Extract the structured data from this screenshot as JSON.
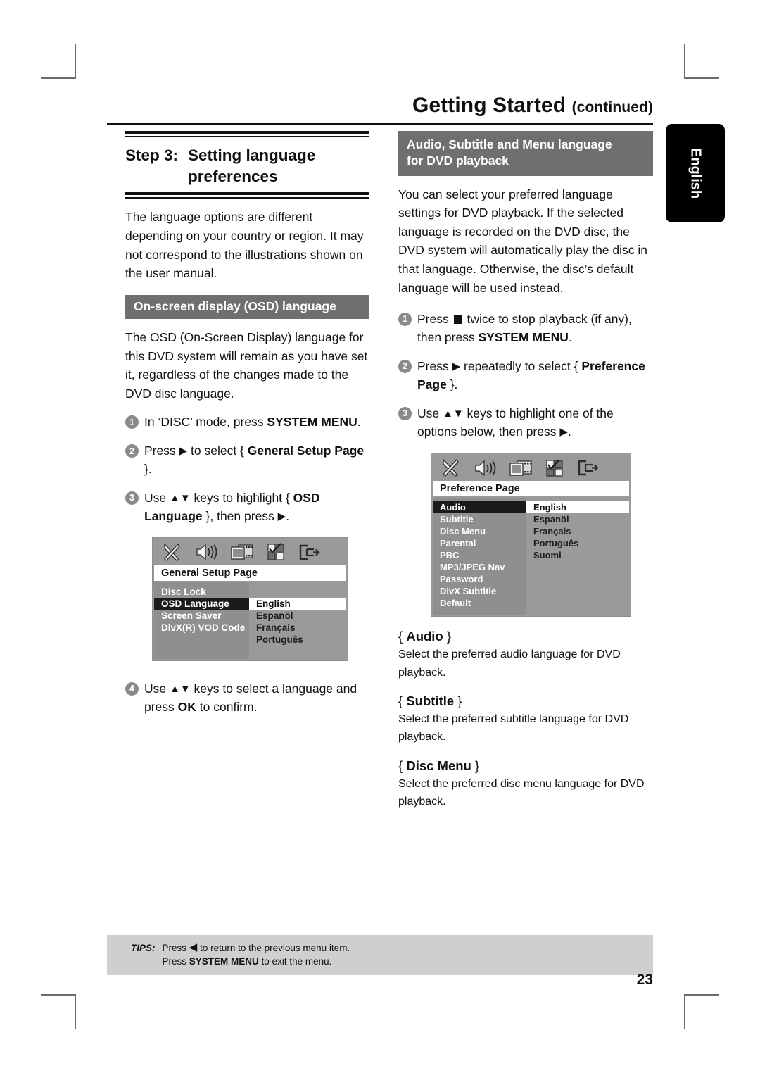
{
  "header": {
    "title": "Getting Started",
    "continued": "(continued)"
  },
  "side_tab": {
    "label": "English"
  },
  "left_column": {
    "step_label": "Step 3:",
    "step_title_line1": "Setting language",
    "step_title_line2": "preferences",
    "intro": "The language options are different depending on your country or region. It may not correspond to the illustrations shown on the user manual.",
    "section_bar": "On-screen display (OSD) language",
    "section_body": "The OSD (On-Screen Display) language for this DVD system will remain as you have set it, regardless of the changes made to the DVD disc language.",
    "steps": [
      {
        "num": "1",
        "html": "In &#8216;DISC&#8217; mode, press <b>SYSTEM MENU</b>."
      },
      {
        "num": "2",
        "html": "Press <span class=\"ar\">&#9654;</span> to select { <b>General Setup Page</b> }."
      },
      {
        "num": "3",
        "html": "Use <span class=\"ar\">&#9650;&#9660;</span> keys to highlight { <b>OSD Language</b> }, then press <span class=\"ar\">&#9654;</span>."
      },
      {
        "num": "4",
        "html": "Use <span class=\"ar\">&#9650;&#9660;</span> keys to select a language and press <b>OK</b> to confirm."
      }
    ],
    "osd": {
      "title": "General Setup Page",
      "icons": [
        "tools-icon",
        "speaker-icon",
        "film-icon",
        "preference-icon",
        "exit-icon"
      ],
      "menu_items": [
        "Disc Lock",
        "OSD Language",
        "Screen Saver",
        "DivX(R) VOD Code"
      ],
      "selected_item": "OSD Language",
      "options": [
        "English",
        "Espanöl",
        "Français",
        "Português"
      ],
      "selected_option": "English"
    }
  },
  "right_column": {
    "section_bar_line1": "Audio, Subtitle and Menu language",
    "section_bar_line2": "for DVD playback",
    "intro": "You can select your preferred language settings for DVD playback.  If the selected language is recorded on the DVD disc, the DVD system will automatically play the disc in that language.  Otherwise, the disc’s default language will be used instead.",
    "steps": [
      {
        "num": "1",
        "html": "Press <span class=\"sq\"></span> twice to stop playback (if any), then press <b>SYSTEM MENU</b>."
      },
      {
        "num": "2",
        "html": "Press <span class=\"ar\">&#9654;</span> repeatedly to select { <b>Preference Page</b> }."
      },
      {
        "num": "3",
        "html": "Use <span class=\"ar\">&#9650;&#9660;</span> keys to highlight one of the options below, then press <span class=\"ar\">&#9654;</span>."
      }
    ],
    "osd": {
      "title": "Preference Page",
      "icons": [
        "tools-icon",
        "speaker-icon",
        "film-icon",
        "preference-icon",
        "exit-icon"
      ],
      "menu_items": [
        "Audio",
        "Subtitle",
        "Disc Menu",
        "Parental",
        "PBC",
        "MP3/JPEG Nav",
        "Password",
        "DivX Subtitle",
        "Default"
      ],
      "selected_item": "Audio",
      "options": [
        "English",
        "Espanöl",
        "Français",
        "Português",
        "Suomi"
      ],
      "selected_option": "English"
    },
    "definitions": [
      {
        "term": "Audio",
        "desc": "Select the preferred audio language for DVD playback."
      },
      {
        "term": "Subtitle",
        "desc": "Select the preferred subtitle language for DVD playback."
      },
      {
        "term": "Disc Menu",
        "desc": "Select the preferred disc menu language for DVD playback."
      }
    ]
  },
  "tips": {
    "label": "TIPS:",
    "line1_html": "Press <span class=\"ar\">&#9664;</span> to return to the previous menu item.",
    "line2_html": "Press <b>SYSTEM MENU</b> to exit the menu."
  },
  "page_number": "23",
  "colors": {
    "section_bar": "#706f6f",
    "tips_bar": "#cfcfcf",
    "osd_bg": "#9a9a9a",
    "osd_left_bg": "#8f8f8f",
    "osd_selected": "#1b1b1b",
    "tab_bg": "#000000"
  }
}
